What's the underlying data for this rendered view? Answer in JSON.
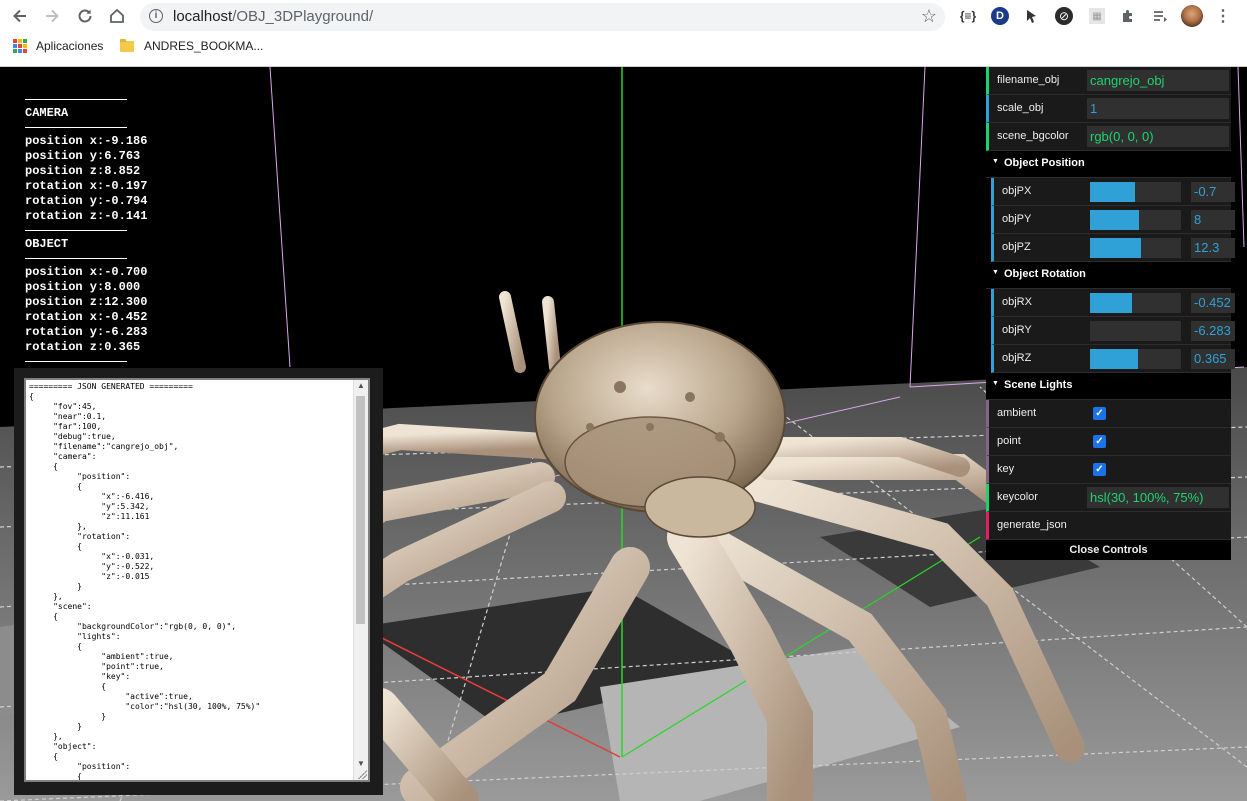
{
  "browser": {
    "url_host": "localhost",
    "url_path": "/OBJ_3DPlayground/",
    "extensions": [
      "{≡}",
      "D",
      "xʸ",
      "⊘",
      "▦",
      "puzzle-icon",
      "playlist-icon",
      "avatar"
    ],
    "bookmarks": [
      {
        "label": "Aplicaciones",
        "icon": "apps-grid-icon"
      },
      {
        "label": "ANDRES_BOOKMA...",
        "icon": "folder-icon"
      }
    ]
  },
  "info": {
    "camera_title": "CAMERA",
    "camera": [
      "position x:-9.186",
      "position y:6.763",
      "position z:8.852",
      "rotation x:-0.197",
      "rotation y:-0.794",
      "rotation z:-0.141"
    ],
    "object_title": "OBJECT",
    "object": [
      "position x:-0.700",
      "position y:8.000",
      "position z:12.300",
      "rotation x:-0.452",
      "rotation y:-6.283",
      "rotation z:0.365"
    ]
  },
  "json_panel": {
    "lines": [
      "========= JSON GENERATED =========",
      "{",
      "\t\"fov\":45,",
      "\t\"near\":0.1,",
      "\t\"far\":100,",
      "\t\"debug\":true,",
      "\t\"filename\":\"cangrejo_obj\",",
      "\t\"camera\":",
      "\t{",
      "\t\t\"position\":",
      "\t\t{",
      "\t\t\t\"x\":-6.416,",
      "\t\t\t\"y\":5.342,",
      "\t\t\t\"z\":11.161",
      "\t\t},",
      "\t\t\"rotation\":",
      "\t\t{",
      "\t\t\t\"x\":-0.031,",
      "\t\t\t\"y\":-0.522,",
      "\t\t\t\"z\":-0.015",
      "\t\t}",
      "\t},",
      "\t\"scene\":",
      "\t{",
      "\t\t\"backgroundColor\":\"rgb(0, 0, 0)\",",
      "\t\t\"lights\":",
      "\t\t{",
      "\t\t\t\"ambient\":true,",
      "\t\t\t\"point\":true,",
      "\t\t\t\"key\":",
      "\t\t\t{",
      "\t\t\t\t\"active\":true,",
      "\t\t\t\t\"color\":\"hsl(30, 100%, 75%)\"",
      "\t\t\t}",
      "\t\t}",
      "\t},",
      "\t\"object\":",
      "\t{",
      "\t\t\"position\":",
      "\t\t{"
    ]
  },
  "gui": {
    "top_rows": [
      {
        "label": "filename_obj",
        "value": "cangrejo_obj",
        "type": "string"
      },
      {
        "label": "scale_obj",
        "value": "1",
        "type": "number"
      },
      {
        "label": "scene_bgcolor",
        "value": "rgb(0, 0, 0)",
        "type": "string"
      }
    ],
    "object_position": {
      "title": "Object Position",
      "rows": [
        {
          "label": "objPX",
          "value": "-0.7",
          "fill": 0.49
        },
        {
          "label": "objPY",
          "value": "8",
          "fill": 0.54
        },
        {
          "label": "objPZ",
          "value": "12.3",
          "fill": 0.56
        }
      ]
    },
    "object_rotation": {
      "title": "Object Rotation",
      "rows": [
        {
          "label": "objRX",
          "value": "-0.452",
          "fill": 0.46
        },
        {
          "label": "objRY",
          "value": "-6.283",
          "fill": 0.0
        },
        {
          "label": "objRZ",
          "value": "0.365",
          "fill": 0.53
        }
      ]
    },
    "scene_lights": {
      "title": "Scene Lights",
      "checkboxes": [
        {
          "label": "ambient",
          "checked": true
        },
        {
          "label": "point",
          "checked": true
        },
        {
          "label": "key",
          "checked": true
        }
      ],
      "keycolor_label": "keycolor",
      "keycolor_value": "hsl(30, 100%, 75%)"
    },
    "generate_label": "generate_json",
    "close_label": "Close Controls"
  },
  "colors": {
    "gui_number": "#2fa1d6",
    "gui_string": "#1ed36f",
    "gui_function": "#e61d5f",
    "gui_boolean": "#806787"
  }
}
